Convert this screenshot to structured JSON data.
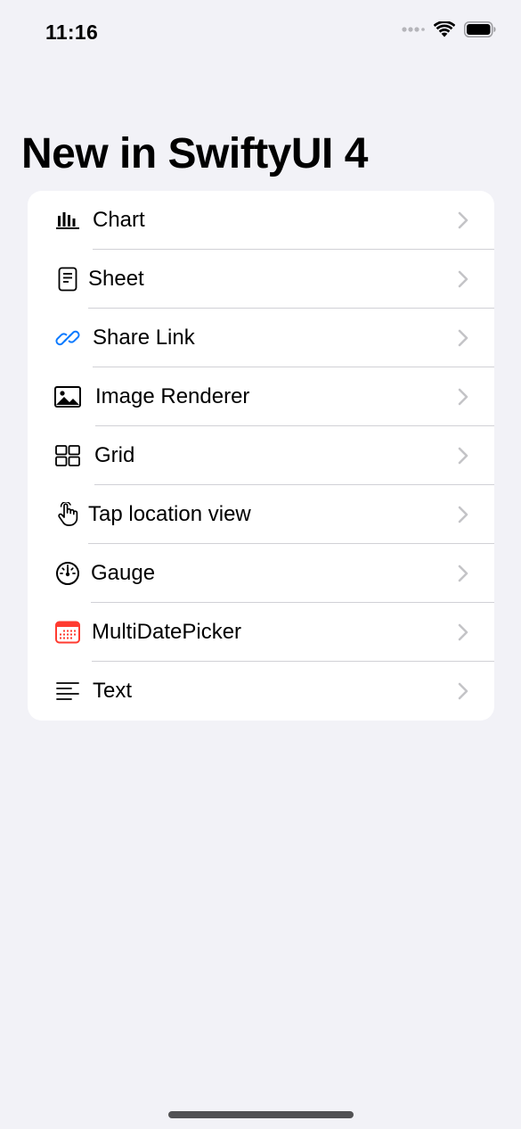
{
  "status_bar": {
    "time": "11:16"
  },
  "nav": {
    "title": "New in SwiftyUI 4"
  },
  "colors": {
    "background": "#f2f2f7",
    "card": "#ffffff",
    "accent_blue": "#0a7aff",
    "calendar_red": "#ff3b30",
    "chevron": "#c4c4c7"
  },
  "list": {
    "items": [
      {
        "label": "Chart",
        "icon": "chart-bar-icon"
      },
      {
        "label": "Sheet",
        "icon": "doc-text-icon"
      },
      {
        "label": "Share Link",
        "icon": "link-icon"
      },
      {
        "label": "Image Renderer",
        "icon": "photo-icon"
      },
      {
        "label": "Grid",
        "icon": "grid-icon"
      },
      {
        "label": "Tap location view",
        "icon": "hand-point-icon"
      },
      {
        "label": "Gauge",
        "icon": "gauge-icon"
      },
      {
        "label": "MultiDatePicker",
        "icon": "calendar-icon"
      },
      {
        "label": "Text",
        "icon": "text-align-left-icon"
      }
    ]
  }
}
